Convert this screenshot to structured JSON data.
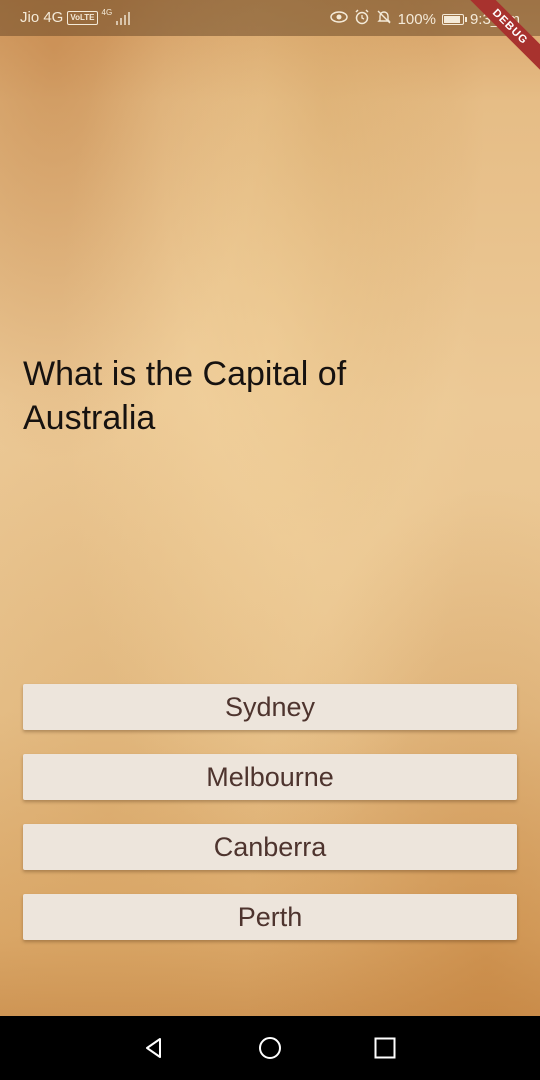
{
  "status_bar": {
    "carrier": "Jio 4G",
    "volte_label": "VoLTE",
    "network_label": "4G",
    "battery_percent": "100%",
    "time": "9:3_pm",
    "icons": [
      "eye-icon",
      "alarm-icon",
      "bell-off-icon",
      "battery-icon"
    ]
  },
  "debug_banner": "DEBUG",
  "question": {
    "text": " What is the Capital of\nAustralia"
  },
  "answers": [
    "Sydney",
    "Melbourne",
    "Canberra",
    "Perth"
  ],
  "nav_bar": {
    "icons": [
      "back-icon",
      "home-icon",
      "recents-icon"
    ]
  },
  "colors": {
    "answer_text": "#4e342e",
    "answer_bg": "#ede5dc",
    "debug_ribbon": "#a8322e",
    "question_text": "#161210"
  }
}
